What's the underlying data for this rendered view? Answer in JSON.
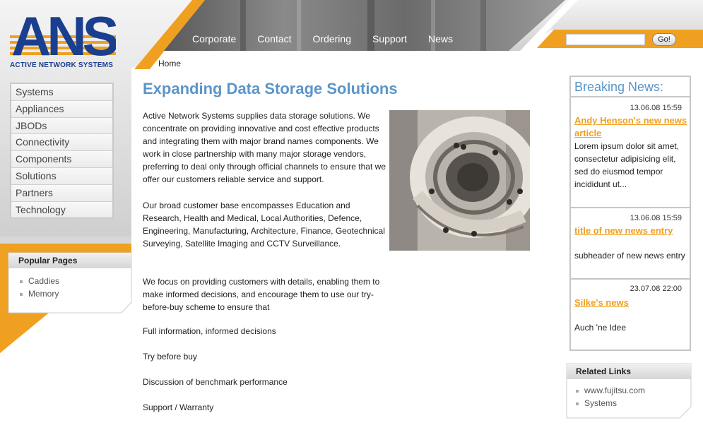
{
  "logo": {
    "mark": "ANS",
    "tagline": "ACTIVE NETWORK SYSTEMS"
  },
  "topnav": [
    "Corporate",
    "Contact",
    "Ordering",
    "Support",
    "News"
  ],
  "search": {
    "value": "",
    "go_label": "Go!"
  },
  "breadcrumb": "Home",
  "sidebar": {
    "items": [
      "Systems",
      "Appliances",
      "JBODs",
      "Connectivity",
      "Components",
      "Solutions",
      "Partners",
      "Technology"
    ],
    "popular_title": "Popular Pages",
    "popular": [
      "Caddies",
      "Memory"
    ]
  },
  "main": {
    "title": "Expanding Data Storage Solutions",
    "para1": "Active Network Systems supplies data storage solutions. We concentrate on providing innovative and cost effective products and integrating them with major brand names components. We work in close partnership with many major storage vendors, preferring to deal only through official channels to ensure that we offer our customers reliable service and support.",
    "para2": "Our broad customer base encompasses Education and Research,  Health and Medical, Local Authorities, Defence, Engineering, Manufacturing, Architecture, Finance, Geotechnical Surveying, Satellite Imaging and CCTV Surveillance.",
    "para3": "We focus on providing customers with details, enabling them to make informed decisions, and encourage them to use our try-before-buy scheme to ensure that",
    "lines": [
      "Full information, informed decisions",
      "Try before buy",
      "Discussion of benchmark performance",
      "Support / Warranty"
    ]
  },
  "news": {
    "heading": "Breaking News:",
    "items": [
      {
        "date": "13.06.08 15:59",
        "title": "Andy Henson's new news article",
        "body": "Lorem ipsum dolor sit amet, consectetur adipisicing elit, sed do eiusmod tempor incididunt ut..."
      },
      {
        "date": "13.06.08 15:59",
        "title": "title of new news entry",
        "body": "subheader of new news entry"
      },
      {
        "date": "23.07.08 22:00",
        "title": "Silke's news",
        "body": "Auch 'ne Idee"
      }
    ]
  },
  "related": {
    "title": "Related Links",
    "items": [
      "www.fujitsu.com",
      "Systems"
    ]
  },
  "colors": {
    "orange": "#f0a020",
    "title_blue": "#5b95c9",
    "logo_blue": "#1b3f8f"
  }
}
